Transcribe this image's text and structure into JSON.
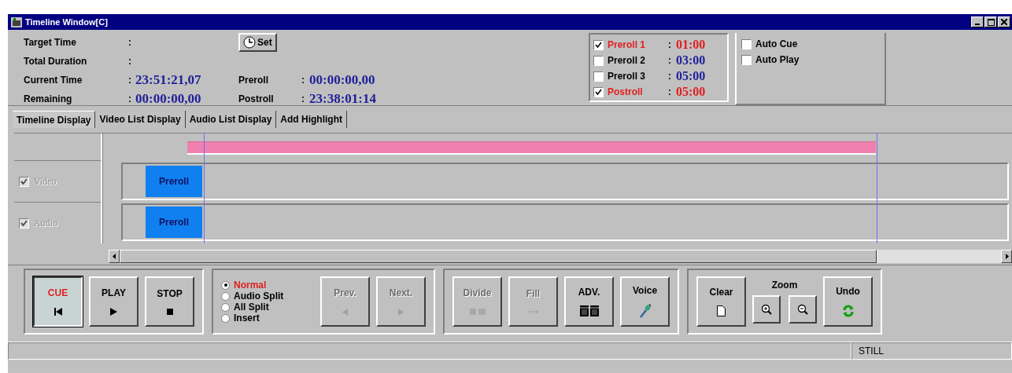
{
  "window": {
    "title": "Timeline Window[C]"
  },
  "info": {
    "rows": [
      {
        "label": "Target Time",
        "colon": ":",
        "value": "",
        "label2": "",
        "value2": ""
      },
      {
        "label": "Total Duration",
        "colon": ":",
        "value": "",
        "label2": "",
        "value2": ""
      },
      {
        "label": "Current Time",
        "colon": ":",
        "value": "23:51:21,07",
        "label2": "Preroll",
        "colon2": ":",
        "value2": "00:00:00,00"
      },
      {
        "label": "Remaining",
        "colon": ":",
        "value": "00:00:00,00",
        "label2": "Postroll",
        "colon2": ":",
        "value2": "23:38:01:14"
      }
    ],
    "set_button": "Set"
  },
  "rolls": [
    {
      "label": "Preroll 1",
      "colon": ":",
      "value": "01:00",
      "checked": true
    },
    {
      "label": "Preroll 2",
      "colon": ":",
      "value": "03:00",
      "checked": false
    },
    {
      "label": "Preroll 3",
      "colon": ":",
      "value": "05:00",
      "checked": false
    },
    {
      "label": "Postroll",
      "colon": ":",
      "value": "05:00",
      "checked": true
    }
  ],
  "auto_options": [
    {
      "label": "Auto Cue",
      "checked": false
    },
    {
      "label": "Auto Play",
      "checked": false
    }
  ],
  "tabs": [
    {
      "label": "Timeline Display",
      "selected": true
    },
    {
      "label": "Video List Display",
      "selected": false
    },
    {
      "label": "Audio List Display",
      "selected": false
    },
    {
      "label": "Add Highlight",
      "selected": false
    }
  ],
  "tracks": [
    {
      "label": "Video",
      "checked": true,
      "disabled": true,
      "clip": "Preroll"
    },
    {
      "label": "Audio",
      "checked": true,
      "disabled": true,
      "clip": "Preroll"
    }
  ],
  "transport": [
    {
      "label": "CUE",
      "kind": "cue",
      "pressed": true
    },
    {
      "label": "PLAY",
      "kind": "play",
      "pressed": false
    },
    {
      "label": "STOP",
      "kind": "stop",
      "pressed": false
    }
  ],
  "modes": [
    {
      "label": "Normal",
      "selected": true
    },
    {
      "label": "Audio Split",
      "selected": false
    },
    {
      "label": "All Split",
      "selected": false
    },
    {
      "label": "Insert",
      "selected": false
    }
  ],
  "nav": [
    {
      "label": "Prev.",
      "kind": "prev",
      "disabled": true
    },
    {
      "label": "Next.",
      "kind": "next",
      "disabled": true
    }
  ],
  "edit": [
    {
      "label": "Divide",
      "kind": "divide",
      "disabled": true
    },
    {
      "label": "Fill",
      "kind": "fill",
      "disabled": true
    },
    {
      "label": "ADV.",
      "kind": "adv",
      "disabled": false
    },
    {
      "label": "Voice",
      "kind": "voice",
      "disabled": false
    }
  ],
  "tools": {
    "clear": "Clear",
    "zoom": "Zoom",
    "undo": "Undo"
  },
  "status_bar": {
    "mode": "STILL"
  }
}
